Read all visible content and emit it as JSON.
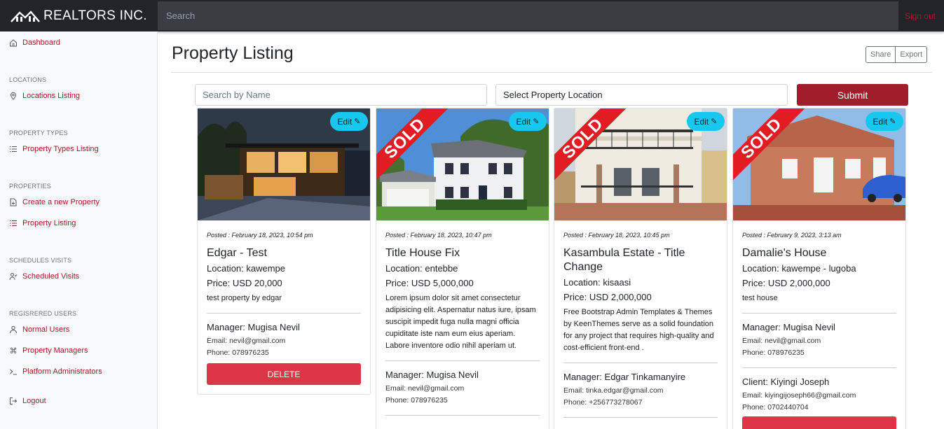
{
  "brand": "REALTORS INC.",
  "search_placeholder": "Search",
  "signout": "Sign out",
  "sidebar": {
    "dashboard": "Dashboard",
    "locations_head": "LOCATIONS",
    "locations_listing": "Locations Listing",
    "property_types_head": "PROPERTY TYPES",
    "property_types_listing": "Property Types Listing",
    "properties_head": "PROPERTIES",
    "create_property": "Create a new Property",
    "property_listing": "Property Listing",
    "schedules_head": "SCHEDULES VISITS",
    "scheduled_visits": "Scheduled Visits",
    "users_head": "REGISRERED USERS",
    "normal_users": "Normal Users",
    "property_managers": "Property Managers",
    "platform_admins": "Platform Administrators",
    "logout": "Logout"
  },
  "main": {
    "title": "Property Listing",
    "share": "Share",
    "export": "Export",
    "search_name_placeholder": "Search by Name",
    "select_location": "Select Property Location",
    "submit": "Submit"
  },
  "colors": {
    "brand_red": "#a11d2b",
    "edit_badge": "#17c7ee",
    "delete": "#dc3545",
    "sold_banner": "#e21c23"
  },
  "cards": [
    {
      "edit": "Edit",
      "sold": false,
      "posted": "Posted : February 18, 2023, 10:54 pm",
      "title": "Edgar - Test",
      "location": "Location: kawempe",
      "price": "Price: USD 20,000",
      "desc": "test property by edgar",
      "manager": "Manager: Mugisa Nevil",
      "email": "Email: nevil@gmail.com",
      "phone": "Phone: 078976235",
      "delete": "DELETE"
    },
    {
      "edit": "Edit",
      "sold": true,
      "sold_label": "SOLD",
      "posted": "Posted : February 18, 2023, 10:47 pm",
      "title": "Title House Fix",
      "location": "Location: entebbe",
      "price": "Price: USD 5,000,000",
      "desc": "Lorem ipsum dolor sit amet consectetur adipisicing elit. Aspernatur natus iure, ipsam suscipit impedit fuga nulla magni officia cupiditate iste nam eum eius aperiam. Labore inventore odio nihil aperiam ut.",
      "manager": "Manager: Mugisa Nevil",
      "email": "Email: nevil@gmail.com",
      "phone": "Phone: 078976235"
    },
    {
      "edit": "Edit",
      "sold": true,
      "sold_label": "SOLD",
      "posted": "Posted : February 18, 2023, 10:45 pm",
      "title": "Kasambula Estate - Title Change",
      "location": "Location: kisaasi",
      "price": "Price: USD 2,000,000",
      "desc": "Free Bootstrap Admin Templates & Themes by KeenThemes serve as a solid foundation for any project that requires high-quality and cost-efficient front-end .",
      "manager": "Manager: Edgar Tinkamanyire",
      "email": "Email: tinka.edgar@gmail.com",
      "phone": "Phone: +256773278067"
    },
    {
      "edit": "Edit",
      "sold": true,
      "sold_label": "SOLD",
      "posted": "Posted : February 9, 2023, 3:13 am",
      "title": "Damalie's House",
      "location": "Location: kawempe - lugoba",
      "price": "Price: USD 2,000,000",
      "desc": "test house",
      "manager": "Manager: Mugisa Nevil",
      "email": "Email: nevil@gmail.com",
      "phone": "Phone: 078976235",
      "client": "Client: Kiyingi Joseph",
      "client_email": "Email: kiyingijoseph66@gmail.com",
      "client_phone": "Phone: 0702440704"
    }
  ]
}
